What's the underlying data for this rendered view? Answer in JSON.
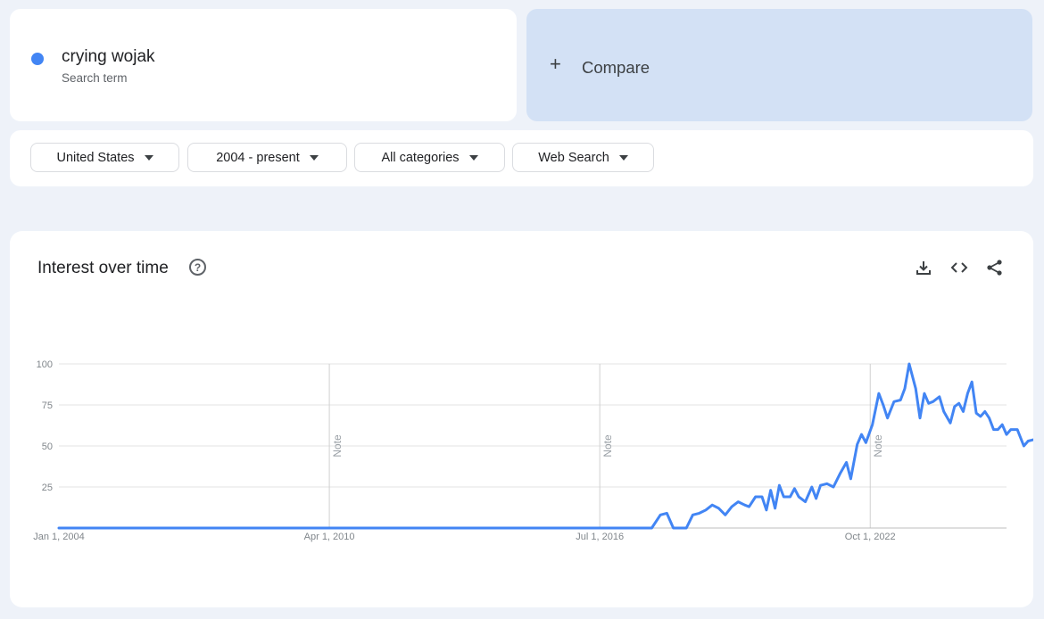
{
  "search_term": {
    "name": "crying wojak",
    "subtitle": "Search term",
    "color": "#4285f4"
  },
  "compare": {
    "plus": "+",
    "label": "Compare"
  },
  "filters": [
    {
      "label": "United States"
    },
    {
      "label": "2004 - present"
    },
    {
      "label": "All categories"
    },
    {
      "label": "Web Search"
    }
  ],
  "chart": {
    "title": "Interest over time",
    "help_icon": "?",
    "tools": [
      "download-icon",
      "embed-code-icon",
      "share-icon"
    ]
  },
  "chart_data": {
    "type": "line",
    "title": "Interest over time",
    "ylim": [
      0,
      100
    ],
    "y_ticks": [
      25,
      50,
      75,
      100
    ],
    "x_ticks": [
      {
        "label": "Jan 1, 2004",
        "x": 2004.0
      },
      {
        "label": "Apr 1, 2010",
        "x": 2010.25
      },
      {
        "label": "Jul 1, 2016",
        "x": 2016.5
      },
      {
        "label": "Oct 1, 2022",
        "x": 2022.75
      }
    ],
    "notes": [
      {
        "x": 2010.25,
        "label": "Note"
      },
      {
        "x": 2016.5,
        "label": "Note"
      },
      {
        "x": 2022.75,
        "label": "Note"
      }
    ],
    "x_range": [
      2004.0,
      2025.9
    ],
    "grid": true,
    "series": [
      {
        "color": "#4285f4",
        "points": [
          [
            2004.0,
            0
          ],
          [
            2017.7,
            0
          ],
          [
            2017.9,
            8
          ],
          [
            2018.05,
            9
          ],
          [
            2018.2,
            0
          ],
          [
            2018.5,
            0
          ],
          [
            2018.65,
            8
          ],
          [
            2018.8,
            9
          ],
          [
            2018.95,
            11
          ],
          [
            2019.1,
            14
          ],
          [
            2019.25,
            12
          ],
          [
            2019.4,
            8
          ],
          [
            2019.55,
            13
          ],
          [
            2019.7,
            16
          ],
          [
            2019.85,
            14
          ],
          [
            2019.95,
            13
          ],
          [
            2020.1,
            19
          ],
          [
            2020.25,
            19
          ],
          [
            2020.35,
            11
          ],
          [
            2020.45,
            23
          ],
          [
            2020.55,
            12
          ],
          [
            2020.65,
            26
          ],
          [
            2020.75,
            19
          ],
          [
            2020.9,
            19
          ],
          [
            2021.0,
            24
          ],
          [
            2021.1,
            19
          ],
          [
            2021.25,
            16
          ],
          [
            2021.4,
            25
          ],
          [
            2021.5,
            18
          ],
          [
            2021.6,
            26
          ],
          [
            2021.75,
            27
          ],
          [
            2021.9,
            25
          ],
          [
            2022.05,
            33
          ],
          [
            2022.2,
            40
          ],
          [
            2022.3,
            30
          ],
          [
            2022.45,
            51
          ],
          [
            2022.55,
            57
          ],
          [
            2022.65,
            52
          ],
          [
            2022.8,
            63
          ],
          [
            2022.95,
            82
          ],
          [
            2023.05,
            75
          ],
          [
            2023.15,
            67
          ],
          [
            2023.3,
            77
          ],
          [
            2023.45,
            78
          ],
          [
            2023.55,
            85
          ],
          [
            2023.65,
            100
          ],
          [
            2023.8,
            85
          ],
          [
            2023.9,
            67
          ],
          [
            2024.0,
            82
          ],
          [
            2024.1,
            76
          ],
          [
            2024.2,
            77
          ],
          [
            2024.35,
            80
          ],
          [
            2024.45,
            71
          ],
          [
            2024.6,
            64
          ],
          [
            2024.7,
            74
          ],
          [
            2024.8,
            76
          ],
          [
            2024.9,
            71
          ],
          [
            2025.0,
            82
          ],
          [
            2025.1,
            89
          ],
          [
            2025.2,
            70
          ],
          [
            2025.3,
            68
          ],
          [
            2025.4,
            71
          ],
          [
            2025.5,
            67
          ],
          [
            2025.6,
            60
          ],
          [
            2025.7,
            60
          ],
          [
            2025.8,
            63
          ],
          [
            2025.9,
            57
          ],
          [
            2026.0,
            60
          ],
          [
            2026.15,
            60
          ],
          [
            2026.3,
            50
          ],
          [
            2026.4,
            53
          ],
          [
            2026.55,
            54
          ],
          [
            2026.65,
            43
          ],
          [
            2026.8,
            55
          ],
          [
            2026.95,
            57
          ],
          [
            2027.1,
            54
          ],
          [
            2027.25,
            49
          ],
          [
            2027.4,
            52
          ],
          [
            2027.55,
            47
          ],
          [
            2027.7,
            50
          ],
          [
            2027.85,
            51
          ],
          [
            2028.0,
            49
          ],
          [
            2028.15,
            53
          ],
          [
            2028.3,
            51
          ],
          [
            2028.45,
            49
          ],
          [
            2028.6,
            56
          ],
          [
            2028.75,
            50
          ],
          [
            2028.9,
            44
          ],
          [
            2029.05,
            36
          ],
          [
            2029.15,
            47
          ]
        ]
      }
    ]
  }
}
